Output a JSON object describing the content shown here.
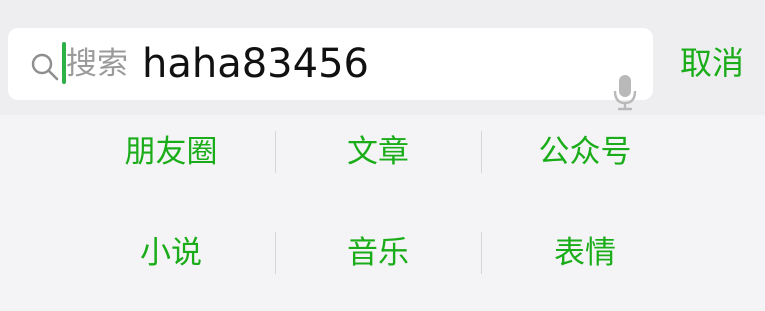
{
  "search": {
    "placeholder": "搜索",
    "query": "haha83456",
    "cancel_label": "取消"
  },
  "icons": {
    "search": "search-icon",
    "mic": "microphone-icon"
  },
  "colors": {
    "accent": "#1aad19",
    "cursor": "#2fb14a",
    "placeholder": "#9a9a9a",
    "background": "#f0f0f3"
  },
  "categories": [
    {
      "label": "朋友圈"
    },
    {
      "label": "文章"
    },
    {
      "label": "公众号"
    },
    {
      "label": "小说"
    },
    {
      "label": "音乐"
    },
    {
      "label": "表情"
    }
  ]
}
